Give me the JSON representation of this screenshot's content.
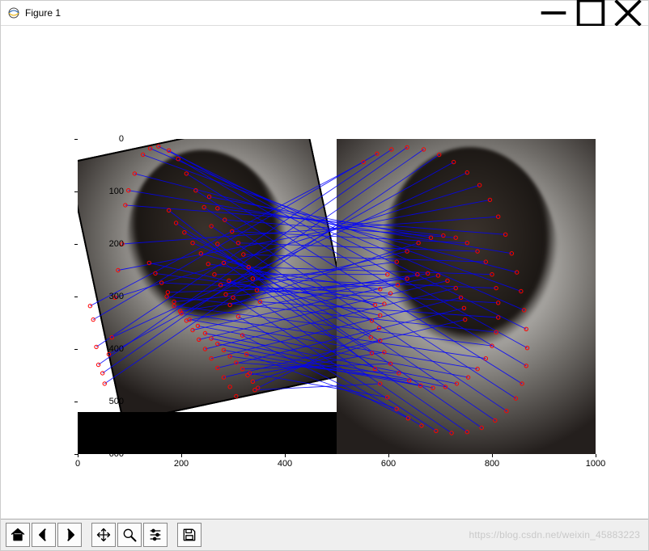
{
  "window": {
    "title": "Figure 1",
    "controls": {
      "minimize": "Minimize",
      "maximize": "Maximize",
      "close": "Close"
    }
  },
  "chart_data": {
    "type": "scatter",
    "title": "",
    "xlabel": "",
    "ylabel": "",
    "xlim": [
      0,
      1000
    ],
    "ylim": [
      600,
      0
    ],
    "x_ticks": [
      0,
      200,
      400,
      600,
      800,
      1000
    ],
    "y_ticks": [
      0,
      100,
      200,
      300,
      400,
      500,
      600
    ],
    "image_layers": [
      {
        "name": "left_rotated_face",
        "extent_x": [
          10,
          520
        ],
        "extent_y": [
          10,
          490
        ],
        "rotation_deg": -12,
        "grayscale": true
      },
      {
        "name": "black_strip",
        "extent_x": [
          0,
          500
        ],
        "extent_y": [
          520,
          600
        ],
        "color": "#000000"
      },
      {
        "name": "right_face",
        "extent_x": [
          500,
          1020
        ],
        "extent_y": [
          0,
          600
        ],
        "grayscale": true
      }
    ],
    "series": [
      {
        "name": "keypoints_left",
        "marker": "o",
        "color": "#ff0000",
        "points": [
          [
            24,
            318
          ],
          [
            30,
            344
          ],
          [
            36,
            396
          ],
          [
            40,
            430
          ],
          [
            48,
            446
          ],
          [
            52,
            466
          ],
          [
            60,
            410
          ],
          [
            66,
            378
          ],
          [
            72,
            302
          ],
          [
            78,
            250
          ],
          [
            86,
            200
          ],
          [
            92,
            126
          ],
          [
            98,
            98
          ],
          [
            110,
            66
          ],
          [
            126,
            30
          ],
          [
            140,
            18
          ],
          [
            156,
            14
          ],
          [
            176,
            22
          ],
          [
            194,
            38
          ],
          [
            210,
            66
          ],
          [
            228,
            98
          ],
          [
            244,
            130
          ],
          [
            258,
            166
          ],
          [
            270,
            200
          ],
          [
            282,
            236
          ],
          [
            292,
            270
          ],
          [
            300,
            302
          ],
          [
            310,
            338
          ],
          [
            318,
            374
          ],
          [
            326,
            410
          ],
          [
            332,
            446
          ],
          [
            342,
            478
          ],
          [
            176,
            136
          ],
          [
            190,
            160
          ],
          [
            206,
            178
          ],
          [
            222,
            198
          ],
          [
            238,
            218
          ],
          [
            252,
            238
          ],
          [
            264,
            258
          ],
          [
            276,
            278
          ],
          [
            286,
            296
          ],
          [
            294,
            316
          ],
          [
            254,
            110
          ],
          [
            270,
            132
          ],
          [
            284,
            154
          ],
          [
            298,
            176
          ],
          [
            310,
            198
          ],
          [
            320,
            220
          ],
          [
            330,
            244
          ],
          [
            338,
            266
          ],
          [
            346,
            288
          ],
          [
            352,
            310
          ],
          [
            172,
            300
          ],
          [
            186,
            318
          ],
          [
            200,
            332
          ],
          [
            216,
            344
          ],
          [
            232,
            356
          ],
          [
            246,
            370
          ],
          [
            258,
            380
          ],
          [
            270,
            390
          ],
          [
            282,
            402
          ],
          [
            294,
            414
          ],
          [
            306,
            426
          ],
          [
            318,
            438
          ],
          [
            328,
            450
          ],
          [
            338,
            462
          ],
          [
            348,
            474
          ],
          [
            138,
            236
          ],
          [
            150,
            256
          ],
          [
            162,
            274
          ],
          [
            174,
            292
          ],
          [
            186,
            310
          ],
          [
            198,
            328
          ],
          [
            210,
            346
          ],
          [
            222,
            364
          ],
          [
            234,
            382
          ],
          [
            246,
            400
          ],
          [
            258,
            418
          ],
          [
            270,
            436
          ],
          [
            282,
            454
          ],
          [
            294,
            472
          ],
          [
            306,
            490
          ]
        ]
      },
      {
        "name": "keypoints_right",
        "marker": "o",
        "color": "#ff0000",
        "points": [
          [
            552,
            44
          ],
          [
            578,
            28
          ],
          [
            606,
            20
          ],
          [
            636,
            16
          ],
          [
            668,
            20
          ],
          [
            698,
            30
          ],
          [
            726,
            44
          ],
          [
            752,
            64
          ],
          [
            776,
            88
          ],
          [
            796,
            116
          ],
          [
            812,
            148
          ],
          [
            826,
            182
          ],
          [
            838,
            218
          ],
          [
            848,
            254
          ],
          [
            856,
            290
          ],
          [
            862,
            326
          ],
          [
            866,
            362
          ],
          [
            868,
            398
          ],
          [
            866,
            432
          ],
          [
            858,
            466
          ],
          [
            846,
            494
          ],
          [
            828,
            518
          ],
          [
            806,
            536
          ],
          [
            780,
            550
          ],
          [
            752,
            558
          ],
          [
            722,
            560
          ],
          [
            692,
            556
          ],
          [
            664,
            546
          ],
          [
            638,
            532
          ],
          [
            616,
            514
          ],
          [
            598,
            492
          ],
          [
            584,
            466
          ],
          [
            574,
            438
          ],
          [
            568,
            408
          ],
          [
            566,
            378
          ],
          [
            568,
            346
          ],
          [
            574,
            316
          ],
          [
            584,
            286
          ],
          [
            598,
            258
          ],
          [
            616,
            234
          ],
          [
            636,
            214
          ],
          [
            658,
            198
          ],
          [
            682,
            188
          ],
          [
            706,
            184
          ],
          [
            730,
            188
          ],
          [
            752,
            198
          ],
          [
            772,
            214
          ],
          [
            788,
            234
          ],
          [
            800,
            258
          ],
          [
            808,
            284
          ],
          [
            812,
            312
          ],
          [
            812,
            340
          ],
          [
            808,
            368
          ],
          [
            800,
            394
          ],
          [
            788,
            418
          ],
          [
            772,
            438
          ],
          [
            754,
            454
          ],
          [
            732,
            466
          ],
          [
            710,
            472
          ],
          [
            686,
            474
          ],
          [
            662,
            470
          ],
          [
            640,
            460
          ],
          [
            620,
            446
          ],
          [
            604,
            428
          ],
          [
            592,
            406
          ],
          [
            584,
            384
          ],
          [
            582,
            360
          ],
          [
            584,
            336
          ],
          [
            592,
            314
          ],
          [
            604,
            294
          ],
          [
            618,
            278
          ],
          [
            636,
            266
          ],
          [
            656,
            258
          ],
          [
            676,
            256
          ],
          [
            696,
            260
          ],
          [
            714,
            270
          ],
          [
            730,
            284
          ],
          [
            740,
            302
          ],
          [
            746,
            322
          ],
          [
            748,
            344
          ]
        ]
      },
      {
        "name": "match_lines",
        "color": "#0000ff",
        "lines_from_to": "keypoints_left -> keypoints_right (index-paired)"
      }
    ]
  },
  "toolbar": {
    "home": "Home",
    "back": "Back",
    "forward": "Forward",
    "pan": "Pan",
    "zoom": "Zoom",
    "configure": "Configure subplots",
    "save": "Save"
  },
  "watermark": "https://blog.csdn.net/weixin_45883223"
}
